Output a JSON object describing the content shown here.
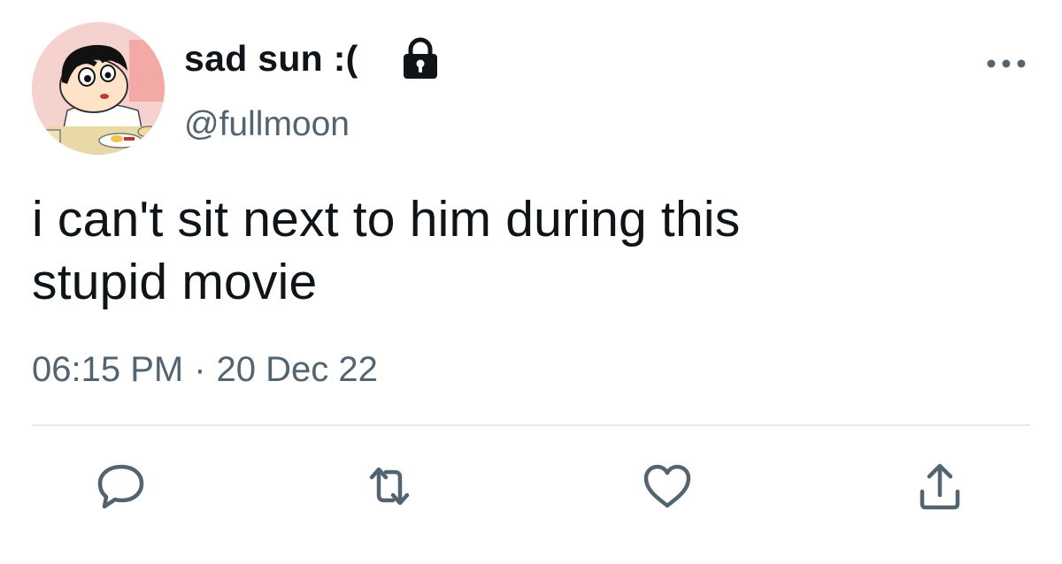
{
  "tweet": {
    "display_name": "sad sun :(",
    "handle": "@fullmoon",
    "text_line1": "i can't sit next to him during this",
    "text_line2": "stupid movie",
    "time": "06:15 PM",
    "separator": "·",
    "date": "20 Dec 22"
  },
  "icons": {
    "lock": "lock-icon",
    "more": "more-icon",
    "reply": "reply-icon",
    "retweet": "retweet-icon",
    "like": "like-icon",
    "share": "share-icon"
  },
  "colors": {
    "text": "#0f1419",
    "secondary": "#536471",
    "icon": "#536471",
    "divider": "#e6e9ec"
  }
}
